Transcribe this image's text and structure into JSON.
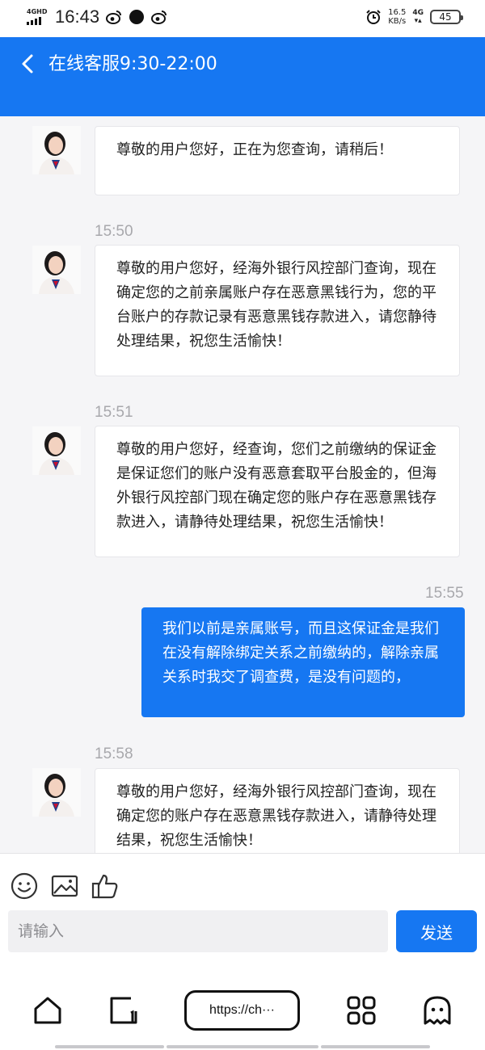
{
  "status_bar": {
    "network_label": "4GHD",
    "time": "16:43",
    "speed_value": "16.5",
    "speed_unit": "KB/s",
    "network_right": "4G",
    "battery": "45"
  },
  "header": {
    "title": "在线客服9:30-22:00",
    "back_icon": "chevron-left-icon",
    "background": "#1677f2"
  },
  "messages": [
    {
      "from": "agent",
      "time": "",
      "text": "尊敬的用户您好，正在为您查询，请稍后！"
    },
    {
      "from": "agent",
      "time": "15:50",
      "text": "尊敬的用户您好，经海外银行风控部门查询，现在确定您的之前亲属账户存在恶意黑钱行为，您的平台账户的存款记录有恶意黑钱存款进入，请您静待处理结果，祝您生活愉快！"
    },
    {
      "from": "agent",
      "time": "15:51",
      "text": "尊敬的用户您好，经查询，您们之前缴纳的保证金是保证您们的账户没有恶意套取平台股金的，但海外银行风控部门现在确定您的账户存在恶意黑钱存款进入，请静待处理结果，祝您生活愉快！"
    },
    {
      "from": "user",
      "time": "15:55",
      "text": "我们以前是亲属账号，而且这保证金是我们在没有解除绑定关系之前缴纳的，解除亲属关系时我交了调查费，是没有问题的，"
    },
    {
      "from": "agent",
      "time": "15:58",
      "text": "尊敬的用户您好，经海外银行风控部门查询，现在确定您的账户存在恶意黑钱存款进入，请静待处理结果，祝您生活愉快！"
    }
  ],
  "composer": {
    "placeholder": "请输入",
    "send_label": "发送",
    "icons": [
      "emoji-icon",
      "image-icon",
      "thumbs-up-icon"
    ]
  },
  "browser": {
    "url": "https://ch···",
    "icons": [
      "home-icon",
      "tabs-icon",
      "apps-grid-icon",
      "ghost-icon"
    ]
  }
}
